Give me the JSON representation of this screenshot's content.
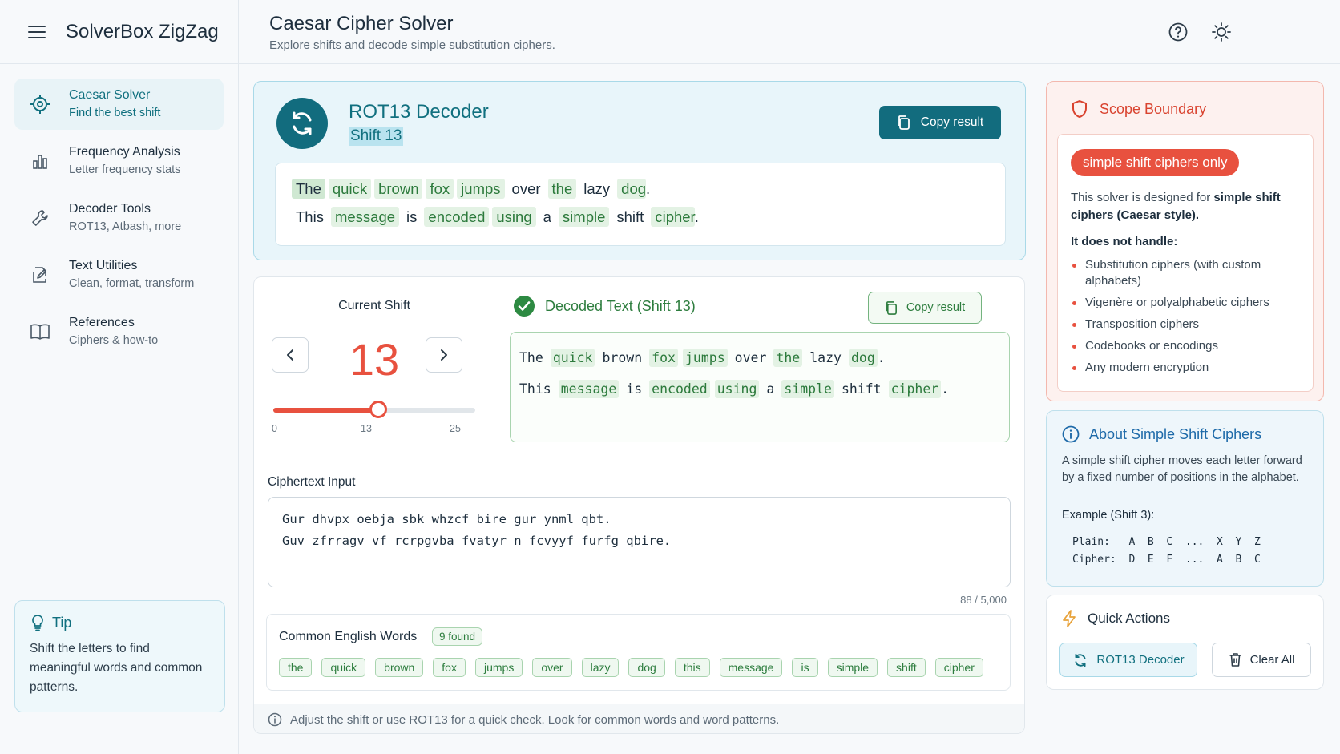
{
  "app": {
    "name": "SolverBox ZigZag"
  },
  "header": {
    "title": "Caesar Cipher Solver",
    "subtitle": "Explore shifts and decode simple substitution ciphers."
  },
  "sidebar": {
    "items": [
      {
        "title": "Caesar Solver",
        "subtitle": "Find the best shift",
        "icon": "target-icon",
        "active": true
      },
      {
        "title": "Frequency Analysis",
        "subtitle": "Letter frequency stats",
        "icon": "bar-chart-icon"
      },
      {
        "title": "Decoder Tools",
        "subtitle": "ROT13, Atbash, more",
        "icon": "wrench-icon"
      },
      {
        "title": "Text Utilities",
        "subtitle": "Clean, format, transform",
        "icon": "edit-document-icon"
      },
      {
        "title": "References",
        "subtitle": "Ciphers & how-to",
        "icon": "book-icon"
      }
    ],
    "tip": {
      "title": "Tip",
      "body": "Shift the letters to find meaningful words and common patterns."
    }
  },
  "rot13": {
    "title": "ROT13 Decoder",
    "subtitle": "Shift 13",
    "copy_label": "Copy result",
    "line1": [
      "The",
      "quick",
      "brown",
      "fox",
      "jumps",
      "over",
      "the",
      "lazy",
      "dog",
      "."
    ],
    "line2": [
      "This",
      "message",
      "is",
      "encoded",
      "using",
      "a",
      "simple",
      "shift",
      "cipher",
      "."
    ]
  },
  "shift": {
    "label": "Current Shift",
    "value": "13",
    "min": "0",
    "max": "25",
    "current_tick": "13",
    "fraction": 0.52
  },
  "decoded": {
    "title": "Decoded Text (Shift 13)",
    "copy_label": "Copy result",
    "line1": [
      "The",
      "quick",
      "brown",
      "fox",
      "jumps",
      "over",
      "the",
      "lazy",
      "dog",
      "."
    ],
    "line2": [
      "This",
      "message",
      "is",
      "encoded",
      "using",
      "a",
      "simple",
      "shift",
      "cipher",
      "."
    ]
  },
  "ciphertext": {
    "label": "Ciphertext Input",
    "line1": "Gur dhvpx oebja sbk whzcf bire gur ynml qbt.",
    "line2": "Guv zfrragv vf rcrpgvba fvatyr n fcvyyf furfg qbire.",
    "count": "88 / 5,000"
  },
  "common_words": {
    "label": "Common English Words",
    "found": "9 found",
    "words": [
      "the",
      "quick",
      "brown",
      "fox",
      "jumps",
      "over",
      "lazy",
      "dog",
      "this",
      "message",
      "is",
      "simple",
      "shift",
      "cipher"
    ]
  },
  "footer": {
    "text": "Adjust the shift or use ROT13 for a quick check. Look for common words and word patterns."
  },
  "scope": {
    "title": "Scope Boundary",
    "pill": "simple shift ciphers only",
    "desc_pre": "This solver is designed for ",
    "desc_bold": "simple shift ciphers (Caesar style).",
    "not_handle": "It does not handle:",
    "items": [
      "Substitution ciphers (with custom alphabets)",
      "Vigenère or polyalphabetic ciphers",
      "Transposition ciphers",
      "Codebooks or encodings",
      "Any modern encryption"
    ]
  },
  "about": {
    "title": "About Simple Shift Ciphers",
    "desc": "A simple shift cipher moves each letter forward by a fixed number of positions in the alphabet.",
    "example_label": "Example (Shift 3):",
    "plain_row": "Plain:   A  B  C  ...  X  Y  Z",
    "cipher_row": "Cipher:  D  E  F  ...  A  B  C"
  },
  "quick_actions": {
    "title": "Quick Actions",
    "rot13_label": "ROT13 Decoder",
    "clear_label": "Clear All"
  },
  "colors": {
    "teal": "#126c7e",
    "accent_red": "#e8513f",
    "green": "#2d7d3e",
    "blue": "#1e6aa9"
  }
}
